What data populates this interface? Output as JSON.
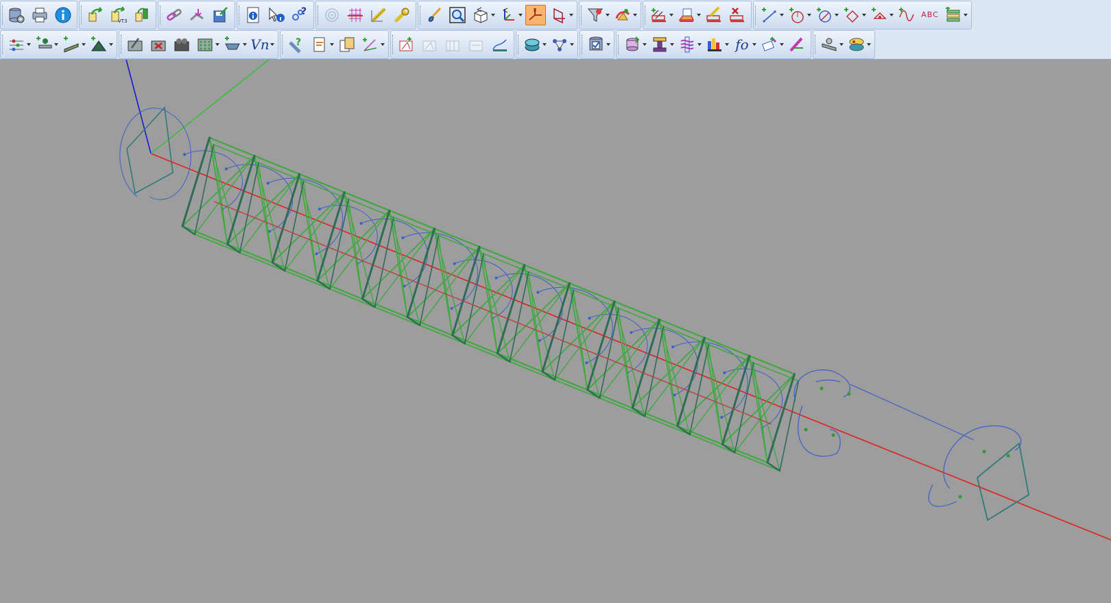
{
  "app": {
    "toolbar_row1": [
      {
        "name": "database-settings-icon"
      },
      {
        "name": "print-icon"
      },
      {
        "name": "info-icon"
      },
      {
        "name": "import-icon"
      },
      {
        "name": "import-vt3-icon",
        "label": "VT3"
      },
      {
        "name": "export-icon"
      },
      {
        "name": "link-icon"
      },
      {
        "name": "merge-icon"
      },
      {
        "name": "save-icon"
      },
      {
        "name": "document-info-icon"
      },
      {
        "name": "pick-info-icon"
      },
      {
        "name": "query-icon"
      },
      {
        "name": "target-icon"
      },
      {
        "name": "grid-icon"
      },
      {
        "name": "measure-icon"
      },
      {
        "name": "wrench-icon"
      },
      {
        "name": "paint-brush-icon"
      },
      {
        "name": "zoom-fit-icon"
      },
      {
        "name": "view-cube-icon"
      },
      {
        "name": "axis-icon"
      },
      {
        "name": "plane-view-icon",
        "active": true
      },
      {
        "name": "plane-tilt-icon"
      },
      {
        "name": "filter-icon"
      },
      {
        "name": "render-icon"
      },
      {
        "name": "section-add-icon"
      },
      {
        "name": "section-edit-icon"
      },
      {
        "name": "section-tool-icon"
      },
      {
        "name": "section-delete-icon"
      },
      {
        "name": "line-add-icon"
      },
      {
        "name": "circle-add-icon"
      },
      {
        "name": "arc-add-icon"
      },
      {
        "name": "polygon-add-icon"
      },
      {
        "name": "point-add-icon"
      },
      {
        "name": "spline-add-icon"
      },
      {
        "name": "text-add-icon",
        "label": "ABC"
      },
      {
        "name": "layers-icon"
      }
    ],
    "toolbar_row2": [
      {
        "name": "align-icon"
      },
      {
        "name": "node-add-icon"
      },
      {
        "name": "member-add-icon"
      },
      {
        "name": "support-add-icon"
      },
      {
        "name": "edit-element-icon"
      },
      {
        "name": "delete-element-icon"
      },
      {
        "name": "group-icon"
      },
      {
        "name": "mesh-icon"
      },
      {
        "name": "load-add-icon"
      },
      {
        "name": "vn-label",
        "label": "Vn"
      },
      {
        "name": "query-tool-icon"
      },
      {
        "name": "report-icon"
      },
      {
        "name": "copy-icon"
      },
      {
        "name": "vector-icon"
      },
      {
        "name": "check-1-icon"
      },
      {
        "name": "check-2-icon"
      },
      {
        "name": "check-3-icon"
      },
      {
        "name": "check-4-icon"
      },
      {
        "name": "plot-icon"
      },
      {
        "name": "results-icon"
      },
      {
        "name": "network-icon"
      },
      {
        "name": "database-check-icon"
      },
      {
        "name": "cylinder-icon"
      },
      {
        "name": "section-property-icon"
      },
      {
        "name": "spring-icon"
      },
      {
        "name": "bar-chart-icon"
      },
      {
        "name": "function-label",
        "label": "fo"
      },
      {
        "name": "pin-icon"
      },
      {
        "name": "pencil-icon"
      },
      {
        "name": "ruler-icon"
      },
      {
        "name": "multi-view-icon"
      }
    ]
  },
  "colors": {
    "background": "#9d9d9d",
    "truss": "#3fa83f",
    "truss_shadow": "#2f6b55",
    "cable": "#3a5fc8",
    "axis_x": "#e02020",
    "axis_y": "#30c030",
    "axis_z": "#1a1ad0",
    "toolbar": "#dbe6f4"
  }
}
